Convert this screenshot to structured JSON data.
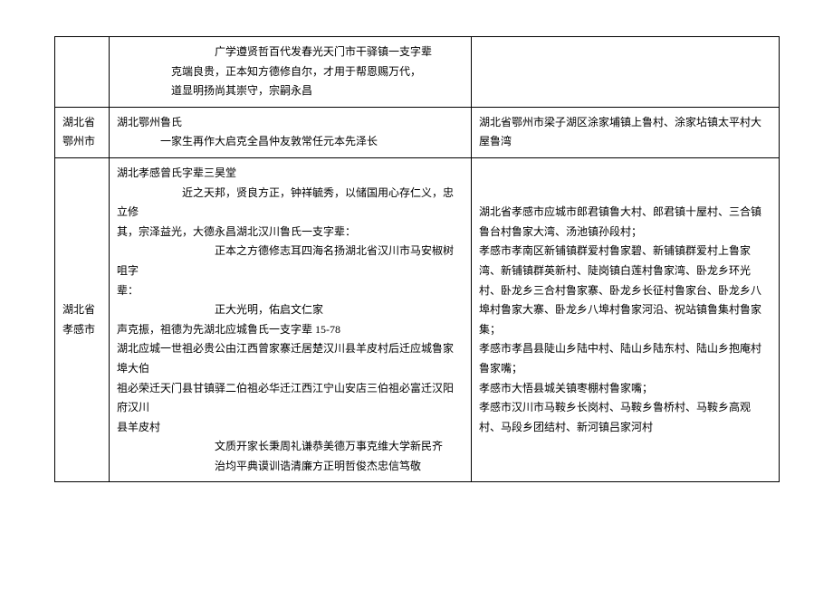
{
  "rows": [
    {
      "col1": "",
      "col2_lines": [
        {
          "cls": "indent1",
          "text": "广学遵贤哲百代发春光天门市干驿镇一支字辈"
        },
        {
          "cls": "indent2",
          "text": "　　　克端良贵，正本知方德修自尔，才用于帮恩赐万代，"
        },
        {
          "cls": "indent2",
          "text": "　　　道显明扬尚其崇守，宗嗣永昌"
        }
      ],
      "col3": ""
    },
    {
      "col1": "湖北省鄂州市",
      "col2_lines": [
        {
          "cls": "",
          "text": "湖北鄂州鲁氏"
        },
        {
          "cls": "indent3",
          "text": "一家生再作大启克全昌仲友敦常任元本先泽长"
        }
      ],
      "col3": "湖北省鄂州市梁子湖区涂家埔镇上鲁村、涂家坫镇太平村大屋鲁湾"
    },
    {
      "col1": "湖北省孝感市",
      "col2_lines": [
        {
          "cls": "",
          "text": "湖北孝感曾氏字辈三昊堂"
        },
        {
          "cls": "indent3",
          "text": "　　近之天邦，贤良方正，钟祥毓秀，以储国用心存仁义，忠立修"
        },
        {
          "cls": "",
          "text": "其，宗泽益光，大德永昌湖北汉川鲁氏一支字辈："
        },
        {
          "cls": "indent1",
          "text": "正本之方德修志耳四海名扬湖北省汉川市马安椒树咀字"
        },
        {
          "cls": "",
          "text": "辈："
        },
        {
          "cls": "indent1",
          "text": "正大光明，佑启文仁家"
        },
        {
          "cls": "",
          "text": "声克振，祖德为先湖北应城鲁氏一支字辈 15-78"
        },
        {
          "cls": "",
          "text": "湖北应城一世祖必贵公由江西曾家寨迁居楚汉川县羊皮村后迁应城鲁家埠大伯"
        },
        {
          "cls": "",
          "text": "祖必荣迁天门县甘镇驿二伯祖必华迁江西江宁山安店三伯祖必富迁汉阳府汉川"
        },
        {
          "cls": "",
          "text": "县羊皮村"
        },
        {
          "cls": "indent1",
          "text": "文质开家长秉周礼谦恭美德万事克维大学新民齐"
        },
        {
          "cls": "indent1",
          "text": "治均平典谟训诰清廉方正明哲俊杰忠信笃敬"
        }
      ],
      "col3": "湖北省孝感市应城市郎君镇鲁大村、郎君镇十屋村、三合镇鲁台村鲁家大湾、汤池镇孙段村；\n孝感市孝南区新铺镇群爱村鲁家碧、新铺镇群爱村上鲁家湾、新铺镇群英新村、陡岗镇白莲村鲁家湾、卧龙乡环光村、卧龙乡三合村鲁家寨、卧龙乡长征村鲁家台、卧龙乡八埠村鲁家大寨、卧龙乡八埠村鲁家河沿、祝站镇鲁集村鲁家集；\n孝感市孝昌县陡山乡陆中村、陆山乡陆东村、陆山乡抱庵村鲁家嘴；\n孝感市大悟县城关镇枣棚村鲁家嘴；\n孝感市汉川市马鞍乡长岗村、马鞍乡鲁桥村、马鞍乡高观村、马段乡团结村、新河镇吕家河村"
    }
  ]
}
